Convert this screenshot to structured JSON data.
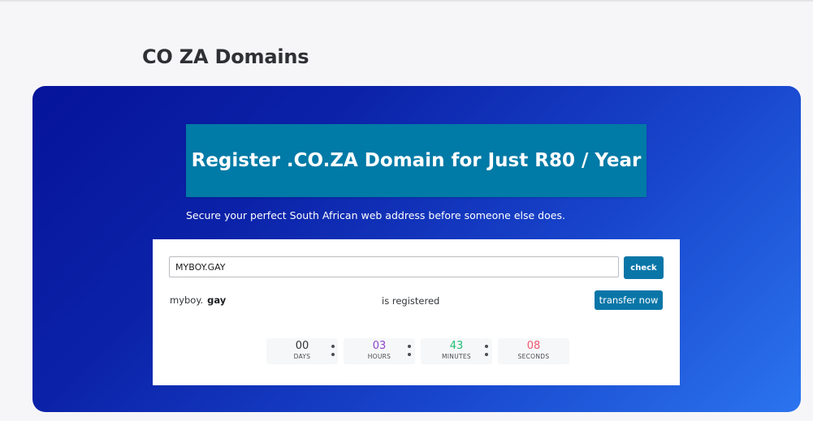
{
  "page": {
    "title": "CO ZA Domains"
  },
  "hero": {
    "banner_title": "Register .CO.ZA Domain for Just R80 / Year",
    "subtitle": "Secure your perfect South African web address before someone else does."
  },
  "search": {
    "input_value": "MYBOY.GAY",
    "check_label": "check"
  },
  "result": {
    "name": "myboy.",
    "tld": "gay",
    "status": "is registered",
    "transfer_label": "transfer now"
  },
  "countdown": {
    "items": [
      {
        "value": "00",
        "label": "DAYS",
        "color": "#333333"
      },
      {
        "value": "03",
        "label": "HOURS",
        "color": "#8e44c9"
      },
      {
        "value": "43",
        "label": "MINUTES",
        "color": "#20c074"
      },
      {
        "value": "08",
        "label": "SECONDS",
        "color": "#f0566e"
      }
    ]
  },
  "colors": {
    "accent": "#0a76a8",
    "banner": "#007aa6",
    "gradient_start": "#06149a",
    "gradient_end": "#2b74ef"
  }
}
